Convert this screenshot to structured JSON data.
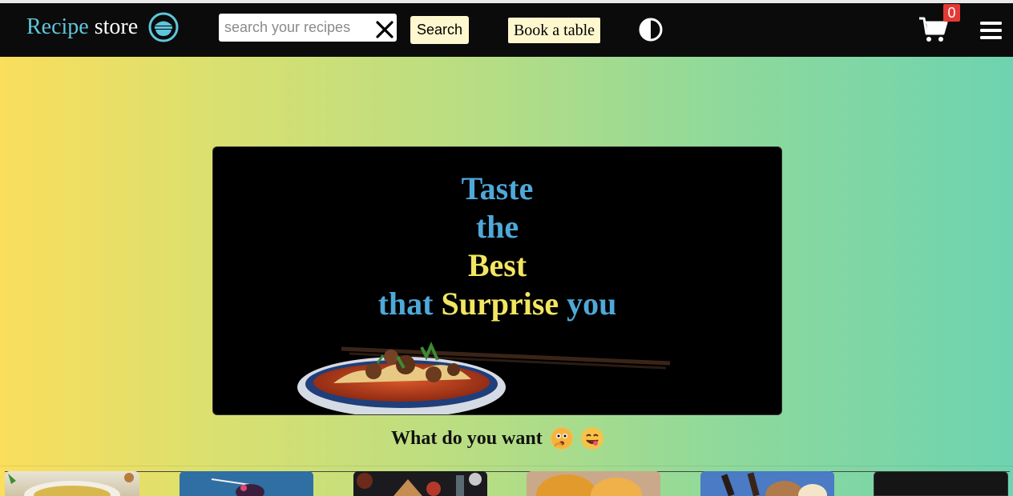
{
  "header": {
    "brand_part1": "Recipe",
    "brand_part2": "store",
    "search": {
      "placeholder": "search your recipes",
      "value": ""
    },
    "search_button": "Search",
    "book_button": "Book a table",
    "cart_count": "0",
    "icons": [
      "bowl-logo-icon",
      "close-icon",
      "half-circle-theme-icon",
      "cart-icon",
      "hamburger-menu-icon"
    ]
  },
  "hero": {
    "line1": "Taste",
    "line2": "the",
    "line3": "Best",
    "line4_a": "that",
    "line4_b": "Surprise",
    "line4_c": "you"
  },
  "section": {
    "prompt": "What do you want",
    "emojis": [
      "thinking-face-emoji",
      "yummy-face-emoji"
    ]
  },
  "colors": {
    "navbar": "#0b0b0b",
    "brand_accent": "#5fc6dc",
    "button_bg": "#fff8cf",
    "hero_blue": "#4fa8d8",
    "hero_yellow": "#f2e661",
    "badge": "#e53935"
  },
  "recipe_cards": [
    {
      "name": "card-1"
    },
    {
      "name": "card-2"
    },
    {
      "name": "card-3"
    },
    {
      "name": "card-4"
    },
    {
      "name": "card-5"
    },
    {
      "name": "card-6"
    }
  ]
}
